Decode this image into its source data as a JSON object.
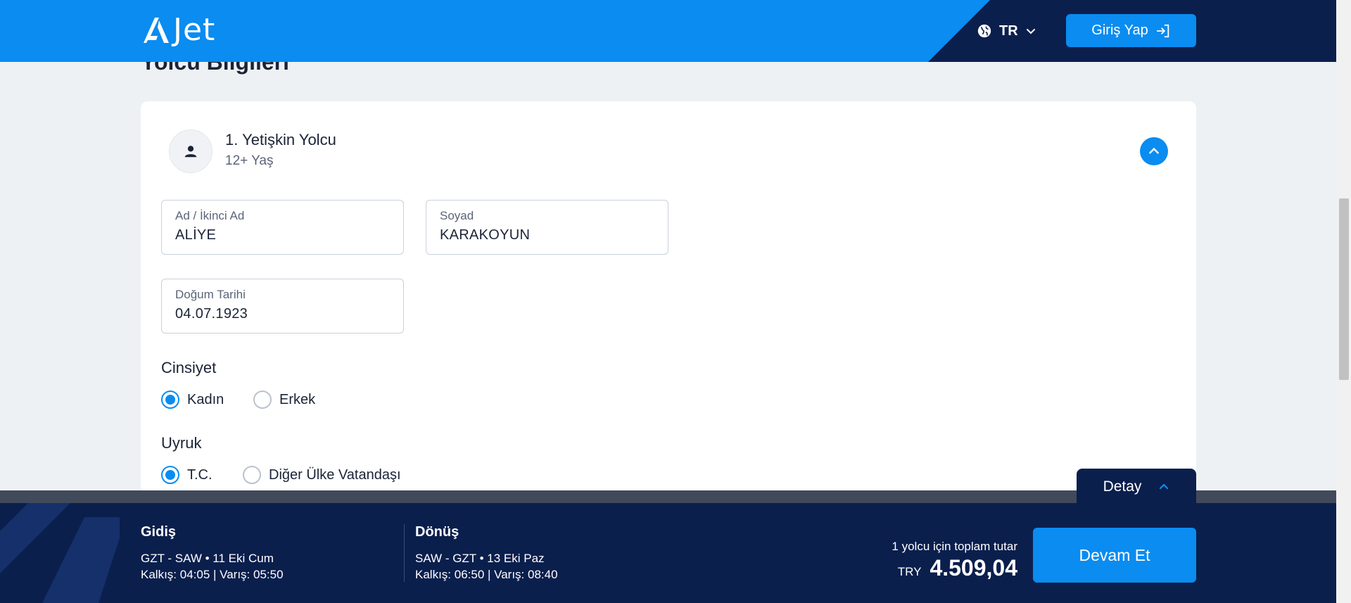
{
  "header": {
    "logo_text": "Jet",
    "language_code": "TR",
    "login_label": "Giriş Yap"
  },
  "page": {
    "section_title": "Yolcu Bilgileri"
  },
  "passenger": {
    "title": "1. Yetişkin Yolcu",
    "subtitle": "12+ Yaş",
    "first_name": {
      "label": "Ad / İkinci Ad",
      "value": "ALİYE"
    },
    "last_name": {
      "label": "Soyad",
      "value": "KARAKOYUN"
    },
    "birth_date": {
      "label": "Doğum Tarihi",
      "value": "04.07.1923"
    },
    "gender": {
      "label": "Cinsiyet",
      "options": [
        {
          "label": "Kadın",
          "selected": true
        },
        {
          "label": "Erkek",
          "selected": false
        }
      ]
    },
    "nationality": {
      "label": "Uyruk",
      "options": [
        {
          "label": "T.C.",
          "selected": true
        },
        {
          "label": "Diğer Ülke Vatandaşı",
          "selected": false
        }
      ]
    }
  },
  "summary": {
    "detail_tab_label": "Detay",
    "outbound": {
      "title": "Gidiş",
      "route": "GZT - SAW • 11 Eki Cum",
      "times": "Kalkış: 04:05 | Varış: 05:50"
    },
    "return": {
      "title": "Dönüş",
      "route": "SAW - GZT • 13 Eki Paz",
      "times": "Kalkış: 06:50 | Varış: 08:40"
    },
    "total_label": "1 yolcu için toplam tutar",
    "currency": "TRY",
    "total_amount": "4.509,04",
    "continue_label": "Devam Et"
  },
  "colors": {
    "brand_blue": "#0a8cf0",
    "navy": "#0b1f4d"
  }
}
